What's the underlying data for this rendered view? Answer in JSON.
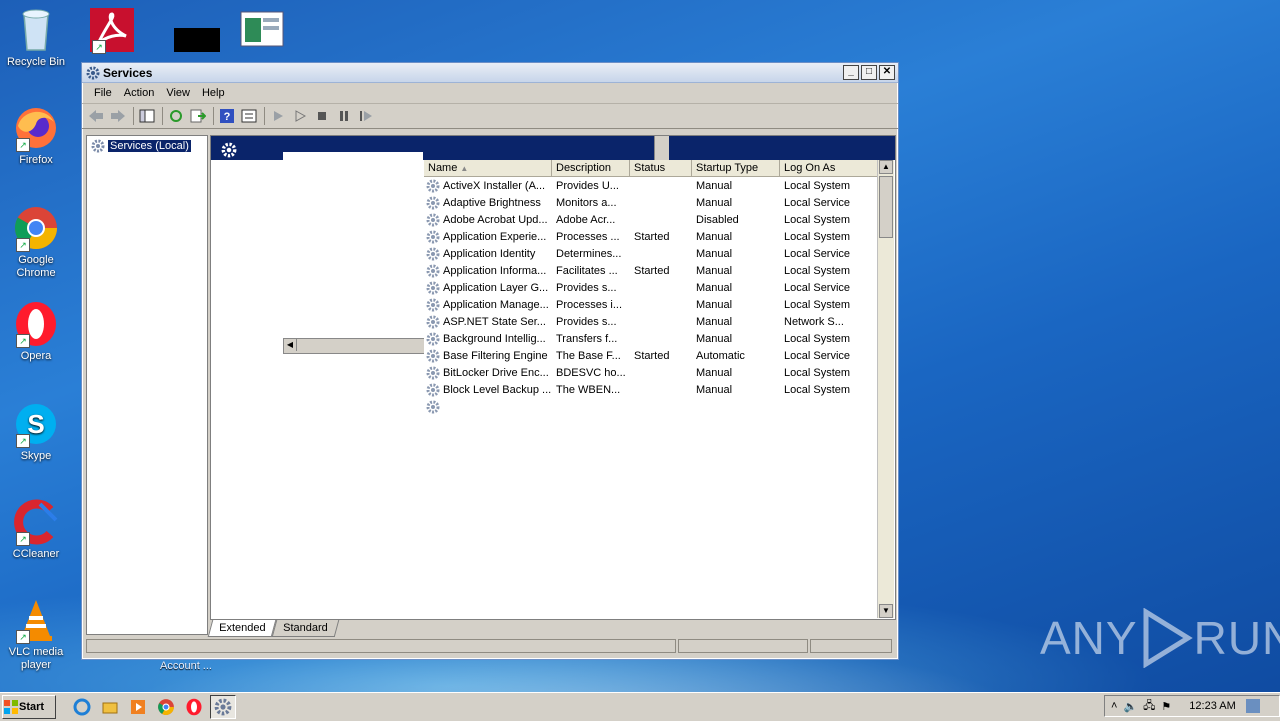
{
  "desktop": {
    "icons": [
      {
        "label": "Recycle Bin",
        "icon": "recycle-bin-icon"
      },
      {
        "label": "",
        "icon": "adobe-acrobat-icon"
      },
      {
        "label": "",
        "icon": "black-rectangle-icon"
      },
      {
        "label": "",
        "icon": "window-app-icon"
      },
      {
        "label": "Firefox",
        "icon": "firefox-icon"
      },
      {
        "label": "Google Chrome",
        "icon": "chrome-icon"
      },
      {
        "label": "Opera",
        "icon": "opera-icon"
      },
      {
        "label": "Skype",
        "icon": "skype-icon"
      },
      {
        "label": "CCleaner",
        "icon": "ccleaner-icon"
      },
      {
        "label": "VLC media player",
        "icon": "vlc-icon"
      }
    ],
    "background_text": "Account ..."
  },
  "window": {
    "title": "Services",
    "menu": [
      "File",
      "Action",
      "View",
      "Help"
    ],
    "tree_root": "Services (Local)",
    "columns": [
      "Name",
      "Description",
      "Status",
      "Startup Type",
      "Log On As"
    ],
    "rows": [
      [
        "ActiveX Installer (A...",
        "Provides U...",
        "",
        "Manual",
        "Local System"
      ],
      [
        "Adaptive Brightness",
        "Monitors a...",
        "",
        "Manual",
        "Local Service"
      ],
      [
        "Adobe Acrobat Upd...",
        "Adobe Acr...",
        "",
        "Disabled",
        "Local System"
      ],
      [
        "Application Experie...",
        "Processes ...",
        "Started",
        "Manual",
        "Local System"
      ],
      [
        "Application Identity",
        "Determines...",
        "",
        "Manual",
        "Local Service"
      ],
      [
        "Application Informa...",
        "Facilitates ...",
        "Started",
        "Manual",
        "Local System"
      ],
      [
        "Application Layer G...",
        "Provides s...",
        "",
        "Manual",
        "Local Service"
      ],
      [
        "Application Manage...",
        "Processes i...",
        "",
        "Manual",
        "Local System"
      ],
      [
        "ASP.NET State Ser...",
        "Provides s...",
        "",
        "Manual",
        "Network S..."
      ],
      [
        "Background Intellig...",
        "Transfers f...",
        "",
        "Manual",
        "Local System"
      ],
      [
        "Base Filtering Engine",
        "The Base F...",
        "Started",
        "Automatic",
        "Local Service"
      ],
      [
        "BitLocker Drive Enc...",
        "BDESVC ho...",
        "",
        "Manual",
        "Local System"
      ],
      [
        "Block Level Backup ...",
        "The WBEN...",
        "",
        "Manual",
        "Local System"
      ],
      [
        "",
        "",
        "",
        "",
        ""
      ]
    ],
    "tabs": [
      "Extended",
      "Standard"
    ]
  },
  "taskbar": {
    "start_label": "Start",
    "clock": "12:23 AM"
  },
  "watermark": {
    "text_left": "ANY",
    "text_right": "RUN"
  }
}
